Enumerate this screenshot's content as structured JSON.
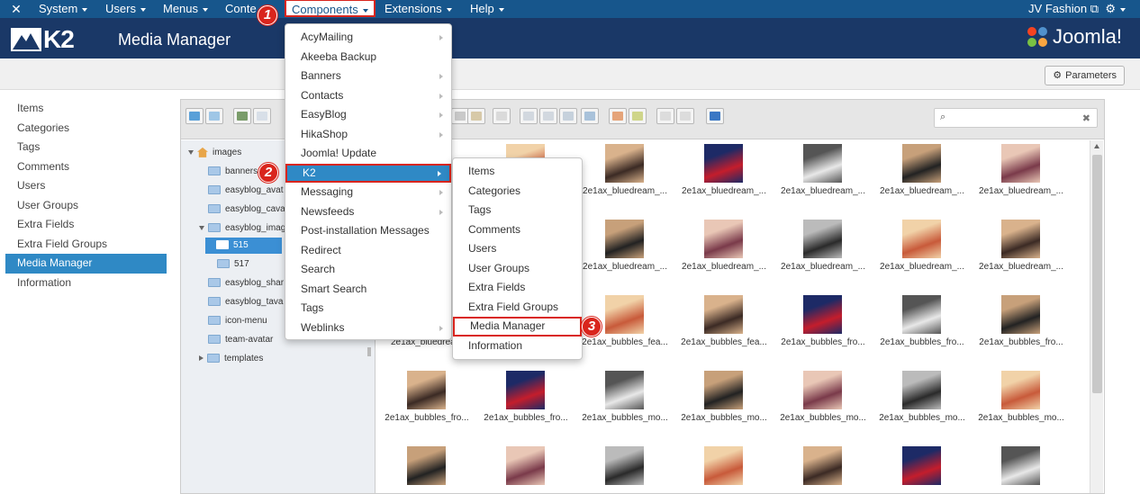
{
  "topnav": {
    "items": [
      "System",
      "Users",
      "Menus",
      "Conte",
      "Components",
      "Extensions",
      "Help"
    ],
    "user": "JV Fashion"
  },
  "header": {
    "logo_text": "K2",
    "title": "Media Manager",
    "brand": "Joomla!"
  },
  "toolbar": {
    "parameters_label": "Parameters"
  },
  "sidebar": {
    "items": [
      {
        "label": "Items"
      },
      {
        "label": "Categories"
      },
      {
        "label": "Tags"
      },
      {
        "label": "Comments"
      },
      {
        "label": "Users"
      },
      {
        "label": "User Groups"
      },
      {
        "label": "Extra Fields"
      },
      {
        "label": "Extra Field Groups"
      },
      {
        "label": "Media Manager",
        "active": true
      },
      {
        "label": "Information"
      }
    ]
  },
  "components_menu": {
    "items": [
      {
        "label": "AcyMailing",
        "submenu": true
      },
      {
        "label": "Akeeba Backup",
        "submenu": false
      },
      {
        "label": "Banners",
        "submenu": true
      },
      {
        "label": "Contacts",
        "submenu": true
      },
      {
        "label": "EasyBlog",
        "submenu": true
      },
      {
        "label": "HikaShop",
        "submenu": true
      },
      {
        "label": "Joomla! Update",
        "submenu": false
      },
      {
        "label": "K2",
        "submenu": true,
        "active": true
      },
      {
        "label": "Messaging",
        "submenu": true
      },
      {
        "label": "Newsfeeds",
        "submenu": true
      },
      {
        "label": "Post-installation Messages",
        "submenu": false
      },
      {
        "label": "Redirect",
        "submenu": false
      },
      {
        "label": "Search",
        "submenu": false
      },
      {
        "label": "Smart Search",
        "submenu": false
      },
      {
        "label": "Tags",
        "submenu": false
      },
      {
        "label": "Weblinks",
        "submenu": true
      }
    ]
  },
  "k2_menu": {
    "items": [
      "Items",
      "Categories",
      "Tags",
      "Comments",
      "Users",
      "User Groups",
      "Extra Fields",
      "Extra Field Groups",
      "Media Manager",
      "Information"
    ],
    "highlighted": "Media Manager"
  },
  "steps": [
    "1",
    "2",
    "3"
  ],
  "tree": {
    "root": "images",
    "rows": [
      "banners",
      "easyblog_avat",
      "easyblog_cava",
      "easyblog_imag",
      "515",
      "517",
      "easyblog_shar",
      "easyblog_tava",
      "icon-menu",
      "team-avatar",
      "templates"
    ],
    "selected": "515"
  },
  "thumbs": {
    "rows": [
      [
        "",
        "",
        "2e1ax_bluedream_...",
        "2e1ax_bluedream_...",
        "2e1ax_bluedream_...",
        "2e1ax_bluedream_...",
        "2e1ax_bluedream_..."
      ],
      [
        "",
        "",
        "2e1ax_bluedream_...",
        "2e1ax_bluedream_...",
        "2e1ax_bluedream_...",
        "2e1ax_bluedream_...",
        "2e1ax_bluedream_..."
      ],
      [
        "2e1ax_bluedream",
        "",
        "2e1ax_bubbles_fea...",
        "2e1ax_bubbles_fea...",
        "2e1ax_bubbles_fro...",
        "2e1ax_bubbles_fro...",
        "2e1ax_bubbles_fro..."
      ],
      [
        "2e1ax_bubbles_fro...",
        "2e1ax_bubbles_fro...",
        "2e1ax_bubbles_mo...",
        "2e1ax_bubbles_mo...",
        "2e1ax_bubbles_mo...",
        "2e1ax_bubbles_mo...",
        "2e1ax_bubbles_mo..."
      ],
      [
        "",
        "",
        "",
        "",
        "",
        "",
        ""
      ]
    ]
  },
  "colors": {
    "topbar": "#17568c",
    "header": "#1a3867",
    "active": "#2f89c5",
    "highlight_box": "#d9251d"
  }
}
